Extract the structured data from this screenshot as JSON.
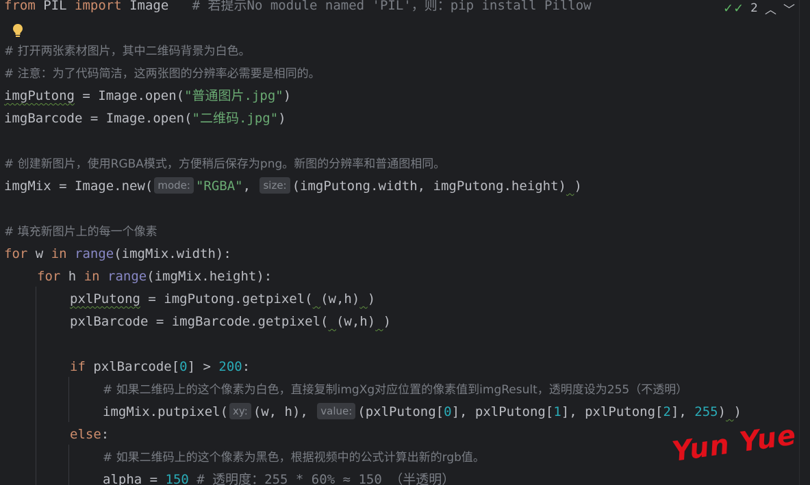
{
  "status": {
    "problem_count": "2"
  },
  "lines": {
    "l0": {
      "kw_from": "from",
      "mod": "PIL",
      "kw_import": "import",
      "cls": "Image",
      "comment": "# 若提示No module named 'PIL'，则：pip install Pillow"
    },
    "l2": "# 打开两张素材图片，其中二维码背景为白色。",
    "l3": "# 注意：为了代码简洁，这两张图的分辨率必需要是相同的。",
    "l4": {
      "var": "imgPutong",
      "rest": " = Image.open(",
      "str": "\"普通图片.jpg\"",
      "close": ")"
    },
    "l5": {
      "var": "imgBarcode",
      "rest": " = Image.open(",
      "str": "\"二维码.jpg\"",
      "close": ")"
    },
    "l7": "# 创建新图片，使用RGBA模式，方便稍后保存为png。新图的分辨率和普通图相同。",
    "l8": {
      "pre": "imgMix = Image.new(",
      "hint1": "mode:",
      "str": "\"RGBA\"",
      "comma": ", ",
      "hint2": "size:",
      "args": "(imgPutong.width, imgPutong.height)",
      "close": ")"
    },
    "l10": "# 填充新图片上的每一个像素",
    "l11": {
      "kw_for": "for",
      "v": " w ",
      "kw_in": "in",
      "fn": "range",
      "args": "(imgMix.width):"
    },
    "l12": {
      "kw_for": "for",
      "v": " h ",
      "kw_in": "in",
      "fn": "range",
      "args": "(imgMix.height):"
    },
    "l13": {
      "var": "pxlPutong",
      "rest": " = imgPutong.getpixel(",
      "args": "(w,h)",
      "close": ")"
    },
    "l14": {
      "var": "pxlBarcode",
      "rest": " = imgBarcode.getpixel(",
      "args": "(w,h)",
      "close": ")"
    },
    "l16": {
      "kw_if": "if",
      "pre": " pxlBarcode[",
      "n0": "0",
      "mid": "] > ",
      "n1": "200",
      "end": ":"
    },
    "l17": "# 如果二维码上的这个像素为白色，直接复制imgXg对应位置的像素值到imgResult，透明度设为255（不透明）",
    "l18": {
      "pre": "imgMix.putpixel(",
      "hint1": "xy:",
      "a1": "(w, h), ",
      "hint2": "value:",
      "a2": "(pxlPutong[",
      "n0": "0",
      "a3": "], pxlPutong[",
      "n1": "1",
      "a4": "], pxlPutong[",
      "n2": "2",
      "a5": "], ",
      "n3": "255",
      "a6": ")",
      "close": ")"
    },
    "l19": {
      "kw_else": "else",
      "end": ":"
    },
    "l20": "# 如果二维码上的这个像素为黑色，根据视频中的公式计算出新的rgb值。",
    "l21": {
      "var": "alpha",
      "eq": " = ",
      "num": "150",
      "cmt": " # 透明度：255 * 60% ≈ 150 （半透明）"
    }
  },
  "watermark": "Yun Yue"
}
